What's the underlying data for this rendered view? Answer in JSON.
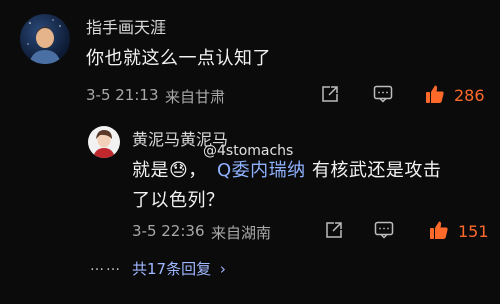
{
  "comment": {
    "username": "指手画天涯",
    "text": "你也就这么一点认知了",
    "timestamp": "3-5 21:13",
    "location": "来自甘肃",
    "likes": "286"
  },
  "reply": {
    "username": "黄泥马黄泥马",
    "text_prefix": "就是",
    "emoji": "😓",
    "text_comma": "，",
    "mention": "Q委内瑞纳",
    "text_suffix": " 有核武还是攻击",
    "text_line2": "了以色列？",
    "timestamp": "3-5 22:36",
    "location": "来自湖南",
    "likes": "151"
  },
  "watermark": "@4stomachs",
  "more": {
    "dots": "……",
    "label": "共17条回复",
    "chevron": "›"
  },
  "icons": {
    "share": "share-icon",
    "comment": "comment-icon",
    "like": "thumbs-up-icon"
  },
  "colors": {
    "accent": "#ff6a2a",
    "mention": "#8fb2ff",
    "link": "#9fb7ff",
    "background": "#0b0b0c"
  }
}
